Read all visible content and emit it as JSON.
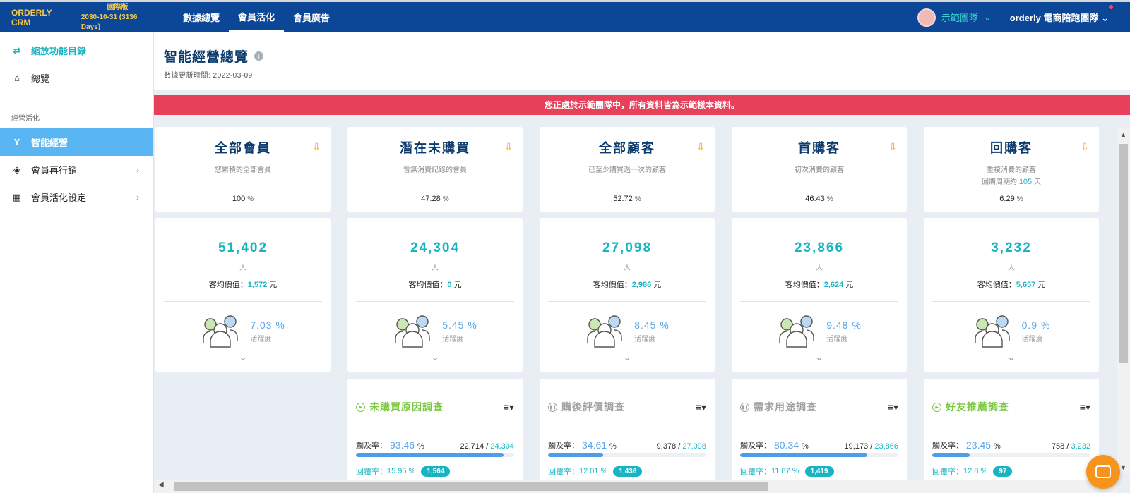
{
  "brand": {
    "name": "ORDERLY CRM",
    "edition": "國際版",
    "expiry": "2030-10-31 (3136 Days)"
  },
  "nav": [
    {
      "label": "數據總覽",
      "active": false
    },
    {
      "label": "會員活化",
      "active": true
    },
    {
      "label": "會員廣告",
      "active": false
    }
  ],
  "top_right": {
    "team_label": "示範團隊",
    "company_label": "orderly 電商陪跑團隊"
  },
  "sidebar": {
    "collapse_label": "縮放功能目錄",
    "overview_label": "總覽",
    "section_label": "經營活化",
    "items": [
      {
        "label": "智能經營",
        "active": true
      },
      {
        "label": "會員再行銷",
        "active": false
      },
      {
        "label": "會員活化設定",
        "active": false
      }
    ]
  },
  "page": {
    "title": "智能經營總覽",
    "updated": "數據更新時間: 2022-03-09"
  },
  "banner": "您正處於示範團隊中，所有資料皆為示範樣本資料。",
  "labels": {
    "avg_prefix": "客均價值：",
    "avg_suffix": "元",
    "person": "人",
    "activity": "活躍度",
    "reach_prefix": "觸及率：",
    "percent": "%",
    "reply_prefix": "回覆率：",
    "period_prefix": "回購周期約",
    "period_suffix": "天"
  },
  "segments": [
    {
      "title": "全部會員",
      "desc": "您累積的全部會員",
      "pct": "100",
      "count": "51,402",
      "avg_value": "1,572",
      "activity_rate": "7.03 %",
      "survey": null
    },
    {
      "title": "潛在未購買",
      "desc": "暫無消費記錄的會員",
      "pct": "47.28",
      "count": "24,304",
      "avg_value": "0",
      "activity_rate": "5.45 %",
      "survey": {
        "title": "未購買原因調查",
        "active": true,
        "reach_rate": "93.46",
        "reached": "22,714",
        "total": "24,304",
        "progress": 0.9346,
        "reply_rate": "15.95",
        "reply_count": "1,564"
      }
    },
    {
      "title": "全部顧客",
      "desc": "已至少購買過一次的顧客",
      "pct": "52.72",
      "count": "27,098",
      "avg_value": "2,986",
      "activity_rate": "8.45 %",
      "survey": {
        "title": "購後評價調查",
        "active": false,
        "reach_rate": "34.61",
        "reached": "9,378",
        "total": "27,098",
        "progress": 0.3461,
        "reply_rate": "12.01",
        "reply_count": "1,436"
      }
    },
    {
      "title": "首購客",
      "desc": "初次消費的顧客",
      "pct": "46.43",
      "count": "23,866",
      "avg_value": "2,624",
      "activity_rate": "9.48 %",
      "survey": {
        "title": "需求用途調查",
        "active": false,
        "reach_rate": "80.34",
        "reached": "19,173",
        "total": "23,866",
        "progress": 0.8034,
        "reply_rate": "11.87",
        "reply_count": "1,419"
      }
    },
    {
      "title": "回購客",
      "desc": "重複消費的顧客",
      "period_days": "105",
      "pct": "6.29",
      "count": "3,232",
      "avg_value": "5,657",
      "activity_rate": "0.9 %",
      "survey": {
        "title": "好友推薦調查",
        "active": true,
        "reach_rate": "23.45",
        "reached": "758",
        "total": "3,232",
        "progress": 0.2345,
        "reply_rate": "12.8",
        "reply_count": "97"
      }
    }
  ],
  "colors": {
    "topbar": "#0b4796",
    "accent": "#19b4c2",
    "banner": "#e7405a",
    "active_sidebar": "#5ab6f2",
    "survey_active": "#7bc843",
    "survey_inactive": "#a0a0a0",
    "download": "#f29a1e"
  }
}
